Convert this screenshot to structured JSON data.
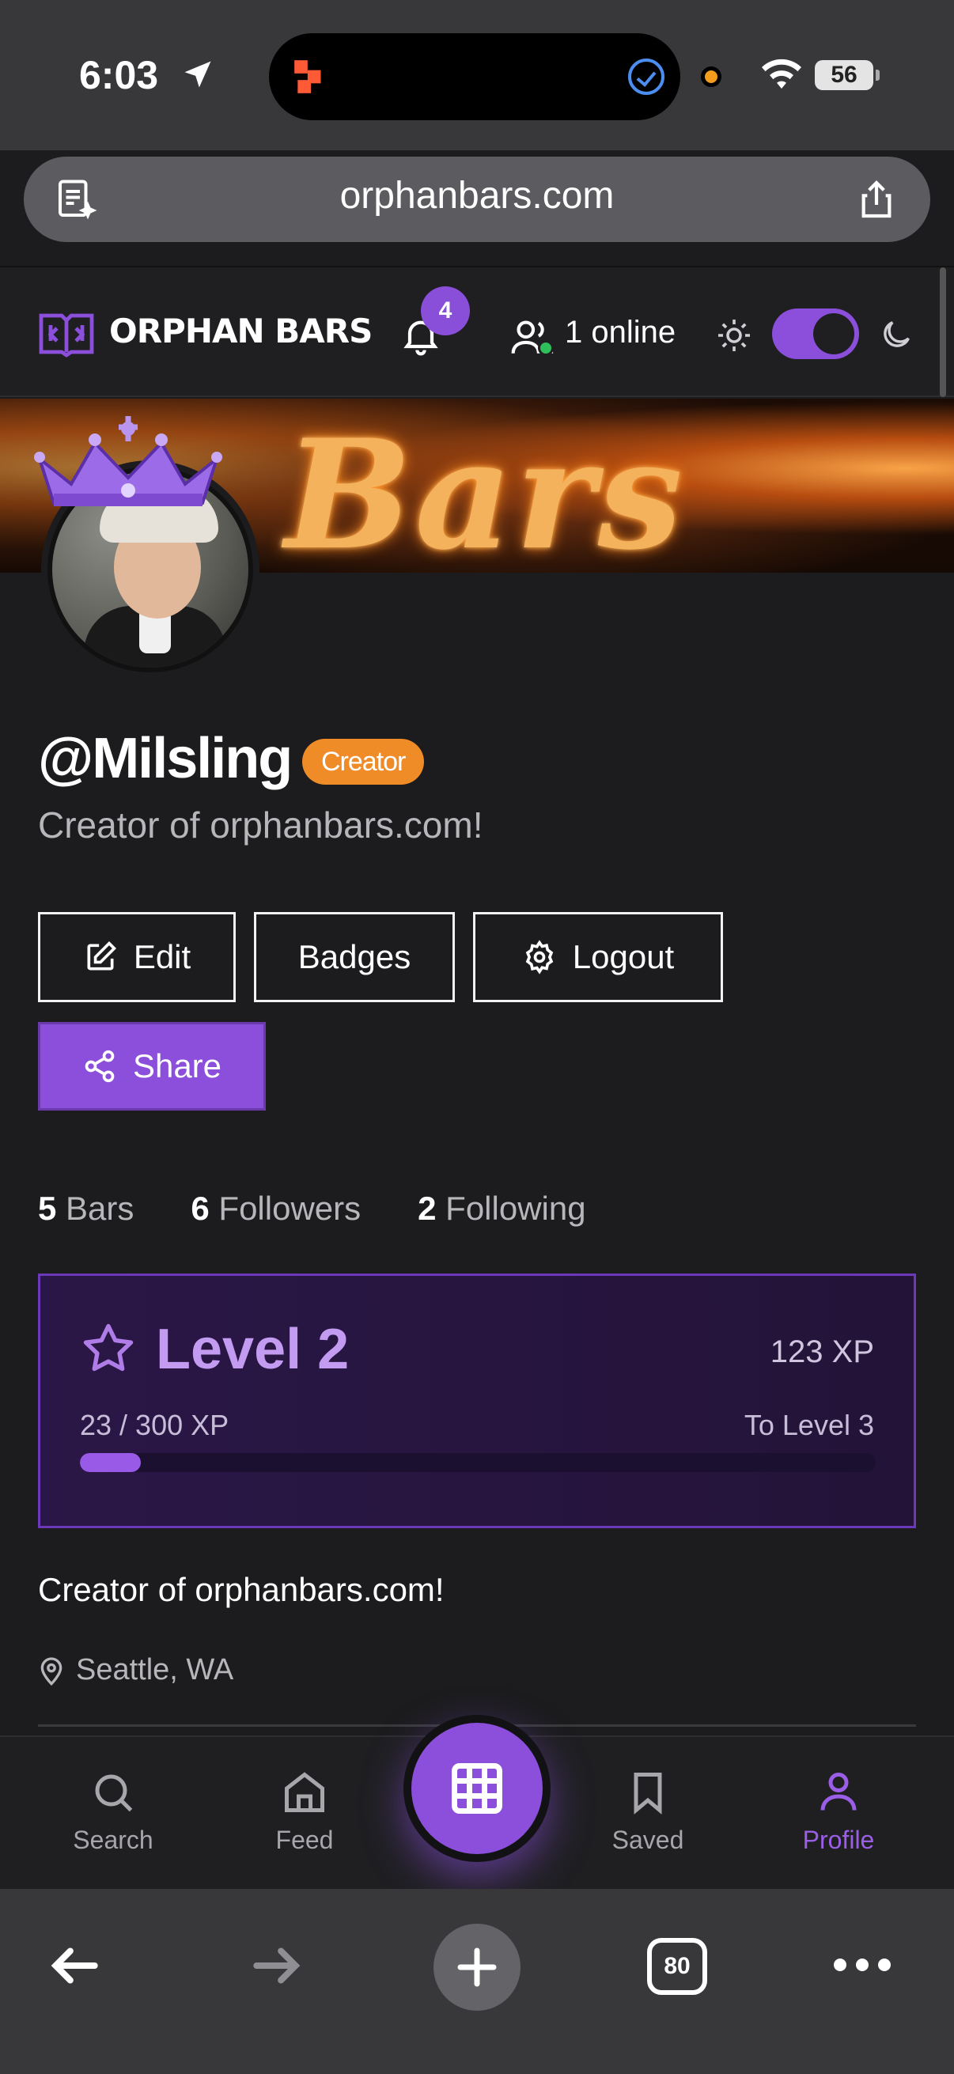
{
  "status_bar": {
    "time": "6:03",
    "battery": "56"
  },
  "browser": {
    "url": "orphanbars.com",
    "tab_count": "80"
  },
  "header": {
    "brand": "ORPHAN BARS",
    "notification_count": "4",
    "online_text": "1 online",
    "dark_mode": true
  },
  "banner": {
    "word": "Bars"
  },
  "profile": {
    "username": "@Milsling",
    "role_badge": "Creator",
    "tagline": "Creator of orphanbars.com!",
    "buttons": {
      "edit": "Edit",
      "badges": "Badges",
      "logout": "Logout",
      "share": "Share"
    },
    "stats": {
      "bars_count": "5",
      "bars_label": "Bars",
      "followers_count": "6",
      "followers_label": "Followers",
      "following_count": "2",
      "following_label": "Following"
    },
    "level": {
      "title": "Level 2",
      "total_xp": "123 XP",
      "progress_text": "23 / 300 XP",
      "next_level": "To Level 3",
      "progress_fraction": 0.077
    },
    "bio": "Creator of orphanbars.com!",
    "location": "Seattle, WA"
  },
  "bottom_nav": {
    "search": "Search",
    "feed": "Feed",
    "saved": "Saved",
    "profile": "Profile",
    "active": "profile"
  },
  "colors": {
    "accent": "#8b4fdb",
    "creator_badge": "#f08c27",
    "background": "#1c1c1e",
    "online": "#2fbf5b"
  }
}
